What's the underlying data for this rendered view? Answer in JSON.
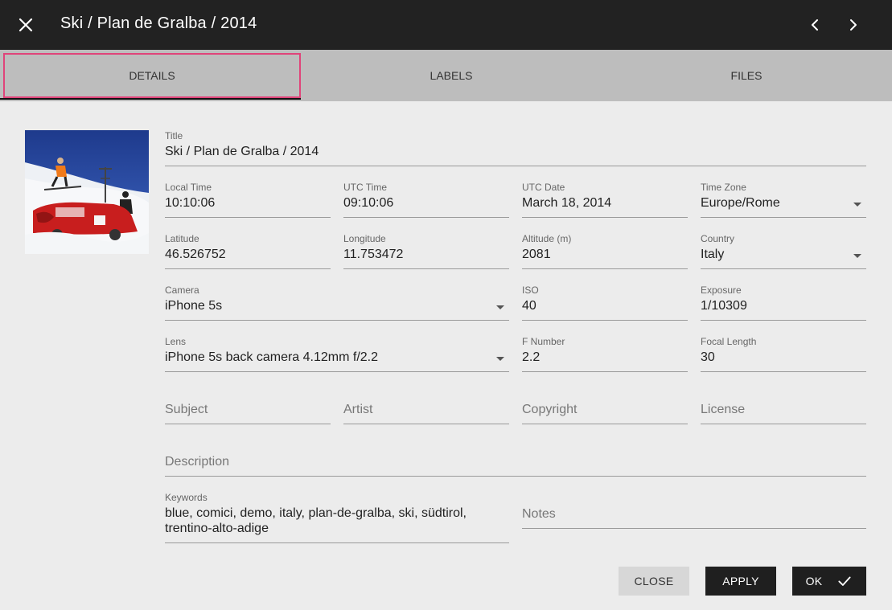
{
  "header": {
    "title": "Ski / Plan de Gralba / 2014"
  },
  "tabs": [
    {
      "label": "DETAILS"
    },
    {
      "label": "LABELS"
    },
    {
      "label": "FILES"
    }
  ],
  "fields": {
    "title": {
      "label": "Title",
      "value": "Ski / Plan de Gralba / 2014"
    },
    "local_time": {
      "label": "Local Time",
      "value": "10:10:06"
    },
    "utc_time": {
      "label": "UTC Time",
      "value": "09:10:06"
    },
    "utc_date": {
      "label": "UTC Date",
      "value": "March 18, 2014"
    },
    "time_zone": {
      "label": "Time Zone",
      "value": "Europe/Rome"
    },
    "latitude": {
      "label": "Latitude",
      "value": "46.526752"
    },
    "longitude": {
      "label": "Longitude",
      "value": "11.753472"
    },
    "altitude": {
      "label": "Altitude (m)",
      "value": "2081"
    },
    "country": {
      "label": "Country",
      "value": "Italy"
    },
    "camera": {
      "label": "Camera",
      "value": "iPhone 5s"
    },
    "iso": {
      "label": "ISO",
      "value": "40"
    },
    "exposure": {
      "label": "Exposure",
      "value": "1/10309"
    },
    "lens": {
      "label": "Lens",
      "value": "iPhone 5s back camera 4.12mm f/2.2"
    },
    "f_number": {
      "label": "F Number",
      "value": "2.2"
    },
    "focal_length": {
      "label": "Focal Length",
      "value": "30"
    },
    "subject": {
      "placeholder": "Subject"
    },
    "artist": {
      "placeholder": "Artist"
    },
    "copyright": {
      "placeholder": "Copyright"
    },
    "license": {
      "placeholder": "License"
    },
    "description": {
      "placeholder": "Description"
    },
    "keywords": {
      "label": "Keywords",
      "line1": "blue, comici, demo, italy, plan-de-gralba, ski, südtirol,",
      "line2": "trentino-alto-adige"
    },
    "notes": {
      "placeholder": "Notes"
    }
  },
  "buttons": {
    "close": "CLOSE",
    "apply": "APPLY",
    "ok": "OK"
  },
  "icons": {
    "close": "close-icon",
    "prev": "chevron-left-icon",
    "next": "chevron-right-icon",
    "ok": "check-icon",
    "dropdown": "caret-down-icon"
  },
  "colors": {
    "topbar": "#222222",
    "tabs_bg": "#bdbdbd",
    "active_tab_outline": "#e0447a",
    "body_bg": "#ececec",
    "primary_button": "#1f1f1f"
  }
}
